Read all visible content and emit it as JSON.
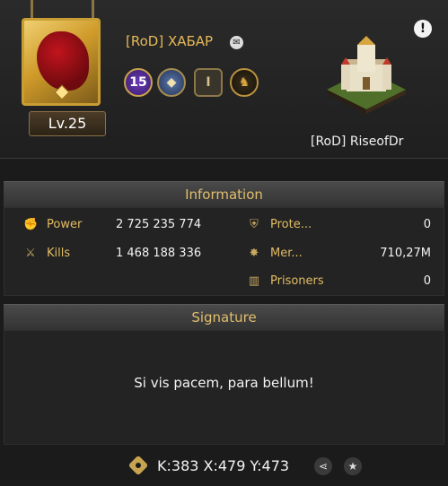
{
  "player": {
    "name": "[RoD] ХАБАР",
    "level": "Lv.25",
    "vip_level": "15",
    "rank_badge": "I"
  },
  "alliance": {
    "name": "[RoD] RiseofDr"
  },
  "information": {
    "title": "Information",
    "stats_left": [
      {
        "label": "Power",
        "value": "2 725 235 774",
        "icon": "fist-icon"
      },
      {
        "label": "Kills",
        "value": "1 468 188 336",
        "icon": "crossed-swords-icon"
      }
    ],
    "stats_right": [
      {
        "label": "Prote...",
        "value": "0",
        "icon": "shield-icon"
      },
      {
        "label": "Mer...",
        "value": "710,27M",
        "icon": "spiked-shield-icon"
      },
      {
        "label": "Prisoners",
        "value": "0",
        "icon": "prison-icon"
      }
    ]
  },
  "signature": {
    "title": "Signature",
    "text": "Si vis pacem, para bellum!"
  },
  "location": {
    "coords": "K:383 X:479 Y:473"
  },
  "colors": {
    "label_gold": "#e2bc63",
    "header_gold": "#e0be6c",
    "background": "#1b1b1b"
  }
}
